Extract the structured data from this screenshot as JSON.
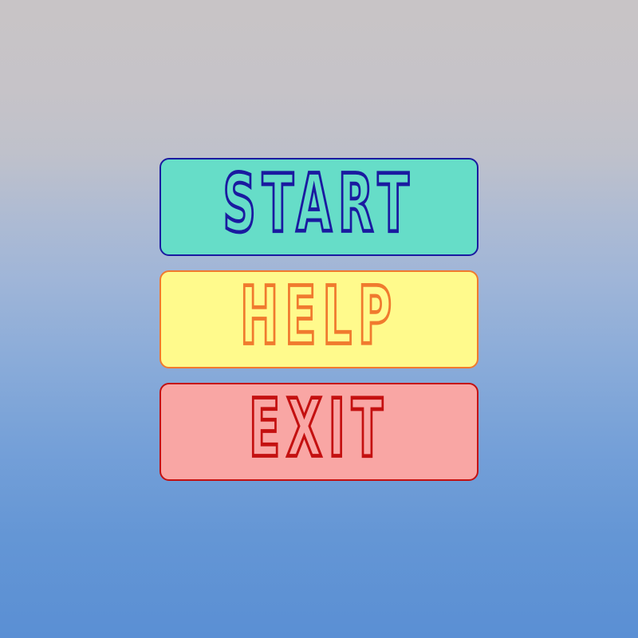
{
  "menu": {
    "start": {
      "label": "START",
      "fill": "#66ddc8",
      "border": "#1a1aa0",
      "text_outline": "#1a1aa0"
    },
    "help": {
      "label": "HELP",
      "fill": "#fffa8c",
      "border": "#f07a2e",
      "text_outline": "#f07a2e"
    },
    "exit": {
      "label": "EXIT",
      "fill": "#f9a6a4",
      "border": "#c41010",
      "text_outline": "#c41010"
    }
  }
}
